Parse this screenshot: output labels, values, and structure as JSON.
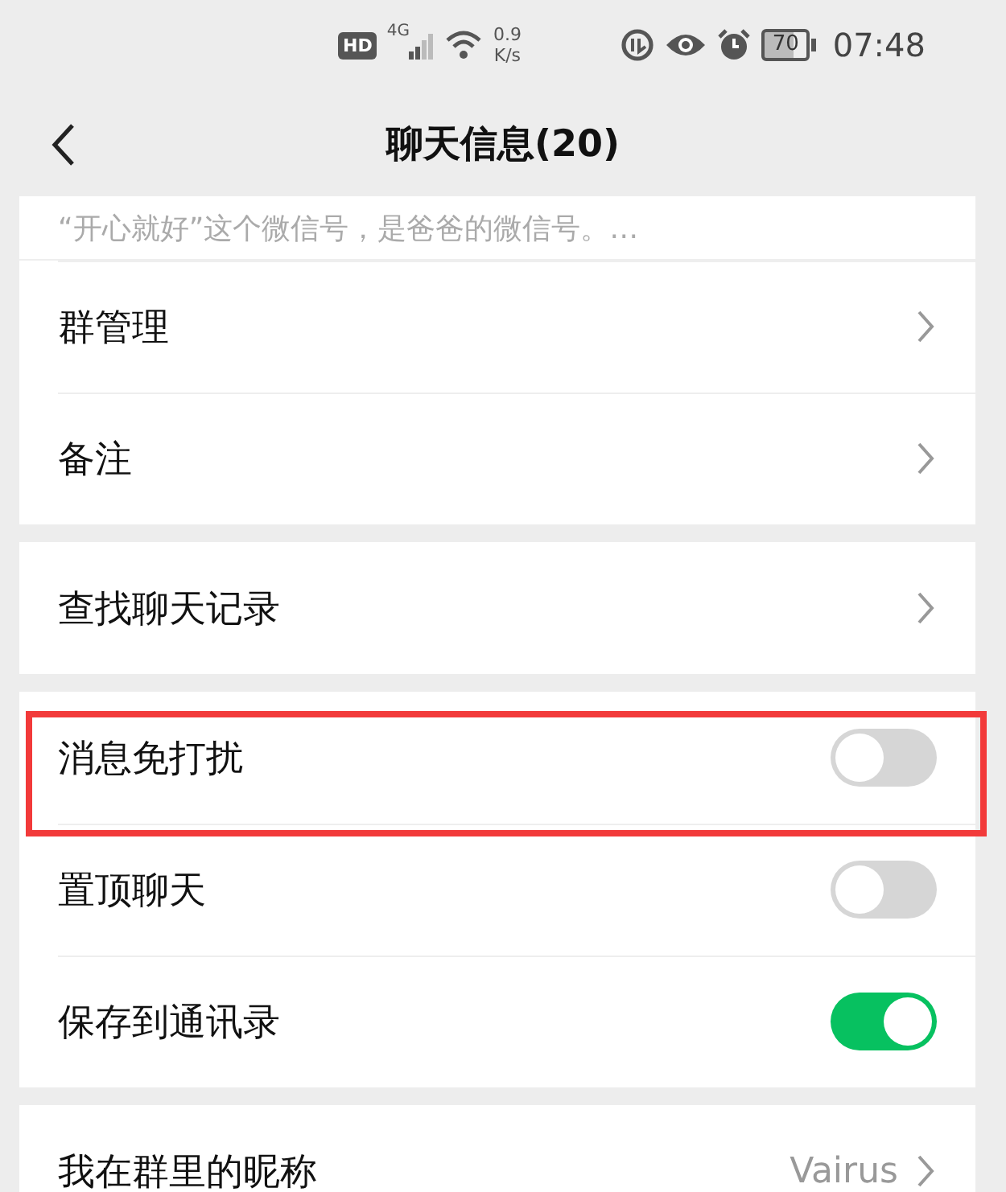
{
  "status_bar": {
    "hd": "HD",
    "network_type": "4G",
    "speed_value": "0.9",
    "speed_unit": "K/s",
    "battery": "70",
    "time": "07:48"
  },
  "header": {
    "title": "聊天信息(20)"
  },
  "sections": [
    {
      "rows": [
        {
          "kind": "note",
          "text": "“开心就好”这个微信号，是爸爸的微信号。…"
        },
        {
          "kind": "link",
          "label": "群管理"
        },
        {
          "kind": "link",
          "label": "备注"
        }
      ]
    },
    {
      "rows": [
        {
          "kind": "link",
          "label": "查找聊天记录"
        }
      ]
    },
    {
      "rows": [
        {
          "kind": "toggle",
          "label": "消息免打扰",
          "on": false,
          "highlighted": true
        },
        {
          "kind": "toggle",
          "label": "置顶聊天",
          "on": false,
          "highlighted": false
        },
        {
          "kind": "toggle",
          "label": "保存到通讯录",
          "on": true,
          "highlighted": false
        }
      ]
    },
    {
      "rows": [
        {
          "kind": "link",
          "label": "我在群里的昵称",
          "value": "Vairus"
        }
      ]
    }
  ]
}
